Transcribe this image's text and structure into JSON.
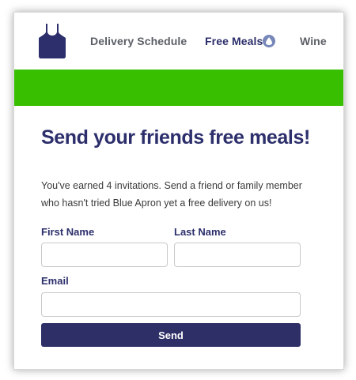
{
  "nav": {
    "logo_icon": "apron-logo-icon",
    "delivery_label": "Delivery Schedule",
    "free_meals_label": "Free Meals",
    "badge_icon": "droplet-icon",
    "wine_label": "Wine"
  },
  "colors": {
    "brand_navy": "#2c2f6b",
    "banner_green": "#37bf00",
    "button_navy": "#2e2f67",
    "badge_blue": "#7787b9"
  },
  "main": {
    "headline": "Send your friends free meals!",
    "intro": "You've earned 4 invitations. Send a friend or family member who hasn't tried Blue Apron yet a free delivery on us!"
  },
  "form": {
    "first_name_label": "First Name",
    "first_name_value": "",
    "last_name_label": "Last Name",
    "last_name_value": "",
    "email_label": "Email",
    "email_value": "",
    "send_label": "Send"
  }
}
